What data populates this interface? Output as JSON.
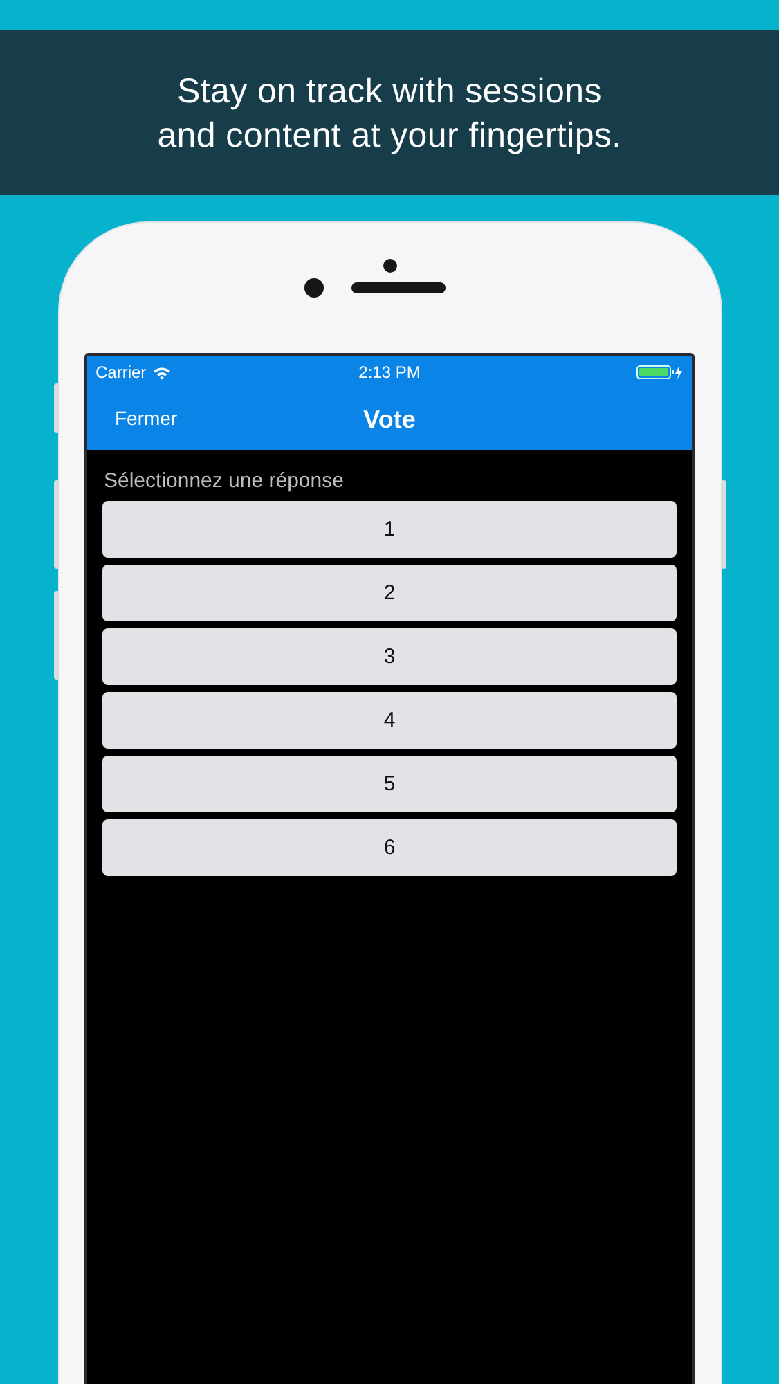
{
  "banner": {
    "lines": [
      "Stay on track with sessions",
      "and content at your fingertips."
    ]
  },
  "status_bar": {
    "carrier": "Carrier",
    "time": "2:13 PM"
  },
  "nav_bar": {
    "left_button": "Fermer",
    "title": "Vote"
  },
  "prompt": "Sélectionnez une réponse",
  "options": [
    {
      "label": "1"
    },
    {
      "label": "2"
    },
    {
      "label": "3"
    },
    {
      "label": "4"
    },
    {
      "label": "5"
    },
    {
      "label": "6"
    }
  ]
}
